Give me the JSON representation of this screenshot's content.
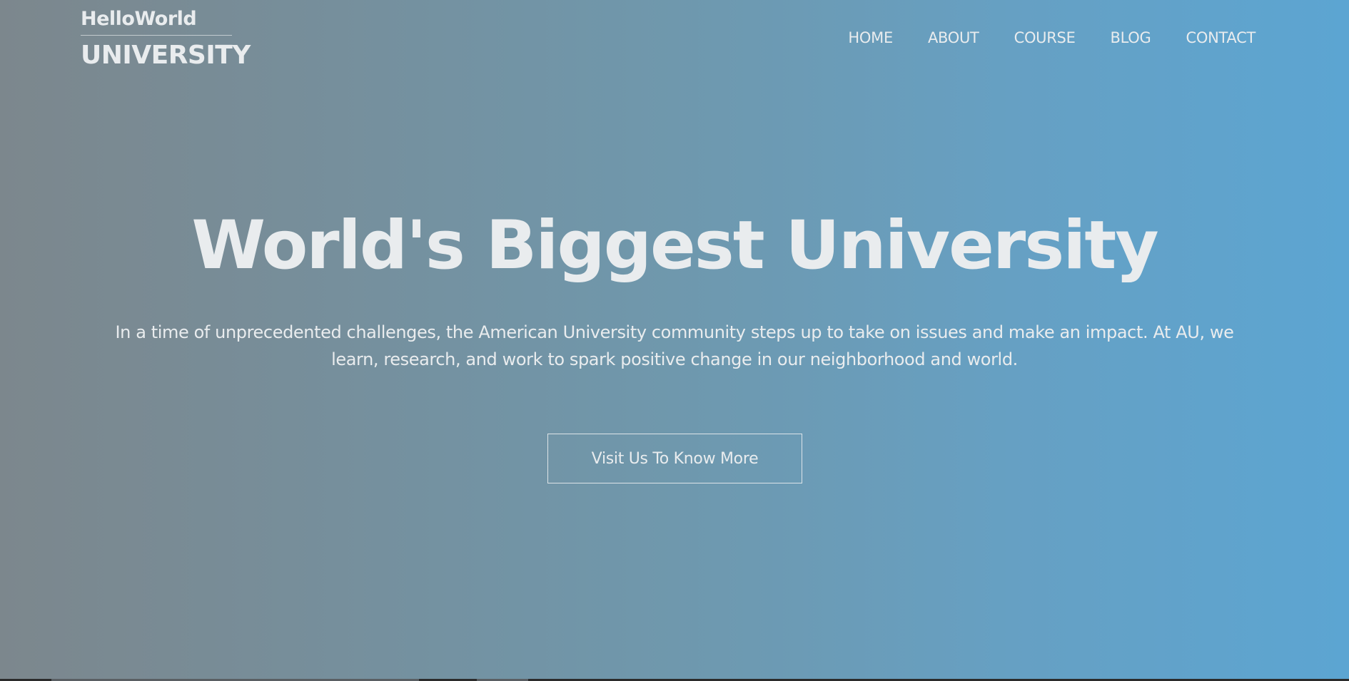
{
  "brand": {
    "name_top": "HelloWorld",
    "name_bottom": "UNIVERSITY"
  },
  "nav": {
    "items": [
      {
        "label": "HOME"
      },
      {
        "label": "ABOUT"
      },
      {
        "label": "COURSE"
      },
      {
        "label": "BLOG"
      },
      {
        "label": "CONTACT"
      }
    ]
  },
  "hero": {
    "title": "World's Biggest University",
    "description": "In a time of unprecedented challenges, the American University community steps up to take on issues and make an impact. At AU, we learn, research, and work to spark positive change in our neighborhood and world.",
    "cta_label": "Visit Us To Know More"
  },
  "colors": {
    "gradient_start": "#7c878d",
    "gradient_end": "#5ca5d2",
    "text": "#e9ecee"
  }
}
